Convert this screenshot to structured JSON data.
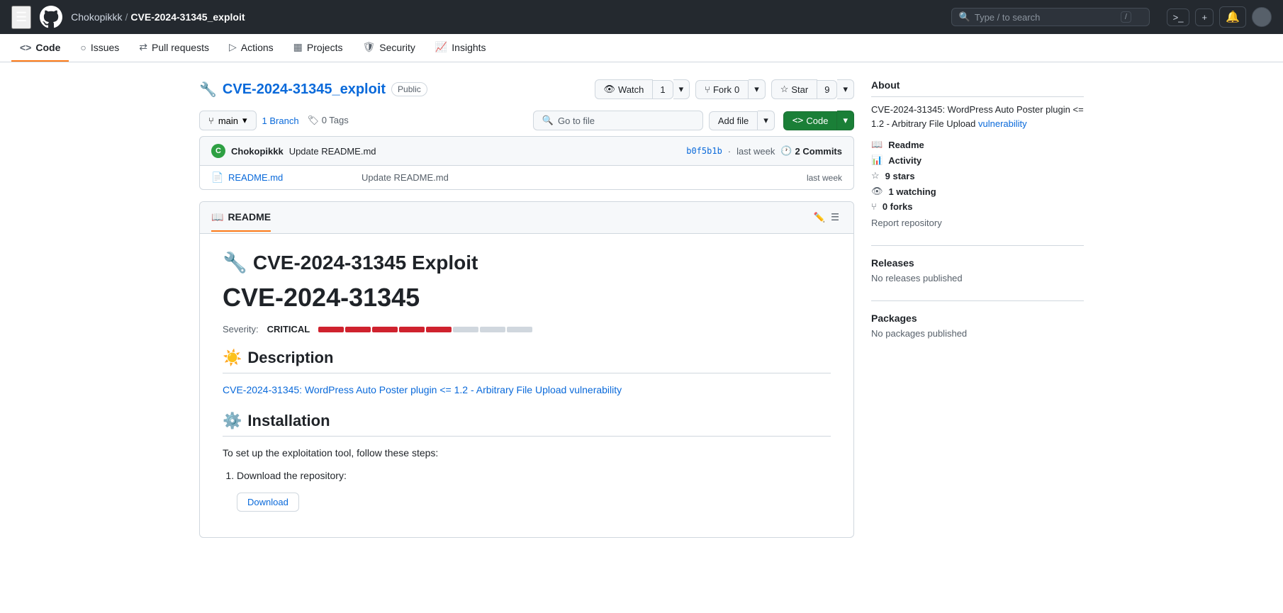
{
  "topbar": {
    "hamburger_label": "☰",
    "user": "Chokopikkk",
    "separator": "/",
    "repo": "CVE-2024-31345_exploit",
    "search_placeholder": "Type / to search",
    "search_shortcut": "/",
    "terminal_icon": ">_",
    "plus_icon": "+",
    "bell_icon": "🔔",
    "menu_icon": "⚙"
  },
  "repo_nav": {
    "items": [
      {
        "label": "Code",
        "icon": "<>",
        "active": true
      },
      {
        "label": "Issues",
        "icon": "○",
        "active": false
      },
      {
        "label": "Pull requests",
        "icon": "⇄",
        "active": false
      },
      {
        "label": "Actions",
        "icon": "▷",
        "active": false
      },
      {
        "label": "Projects",
        "icon": "▦",
        "active": false
      },
      {
        "label": "Security",
        "icon": "🛡",
        "active": false
      },
      {
        "label": "Insights",
        "icon": "📈",
        "active": false
      }
    ]
  },
  "repo": {
    "name": "CVE-2024-31345_exploit",
    "visibility": "Public",
    "avatar_emoji": "🔧"
  },
  "actions": {
    "watch_label": "Watch",
    "watch_count": "1",
    "fork_label": "Fork",
    "fork_count": "0",
    "star_label": "Star",
    "star_count": "9",
    "code_label": "Code"
  },
  "branch": {
    "name": "main",
    "branches_count": "1 Branch",
    "tags_count": "0 Tags",
    "go_to_file_placeholder": "Go to file",
    "add_file_label": "Add file"
  },
  "commit_bar": {
    "author_avatar": "C",
    "author": "Chokopikkk",
    "message": "Update README.md",
    "hash": "b0f5b1b",
    "hash_dot": "·",
    "time": "last week",
    "commits_label": "2 Commits",
    "clock_icon": "🕐"
  },
  "files": [
    {
      "icon": "📄",
      "name": "README.md",
      "commit_msg": "Update README.md",
      "time": "last week"
    }
  ],
  "readme": {
    "section_label": "README",
    "h1_emoji": "🔧",
    "h1_text": "CVE-2024-31345 Exploit",
    "cve_title": "CVE-2024-31345",
    "severity_label": "Severity:",
    "severity_value": "CRITICAL",
    "severity_segments": [
      {
        "filled": true
      },
      {
        "filled": true
      },
      {
        "filled": true
      },
      {
        "filled": true
      },
      {
        "filled": true
      },
      {
        "filled": false
      },
      {
        "filled": false
      },
      {
        "filled": false
      }
    ],
    "desc_emoji": "☀️",
    "desc_heading": "Description",
    "desc_text": "CVE-2024-31345: WordPress Auto Poster plugin <= 1.2 - Arbitrary File Upload vulnerability",
    "install_emoji": "⚙️",
    "install_heading": "Installation",
    "install_intro": "To set up the exploitation tool, follow these steps:",
    "install_step1": "Download the repository:",
    "download_label": "Download"
  },
  "sidebar": {
    "about_title": "About",
    "about_text": "CVE-2024-31345: WordPress Auto Poster plugin <= 1.2 - Arbitrary File Upload vulnerability",
    "about_link_text": "vulnerability",
    "readme_label": "Readme",
    "activity_label": "Activity",
    "stars_label": "9 stars",
    "watching_label": "1 watching",
    "forks_label": "0 forks",
    "report_label": "Report repository",
    "releases_title": "Releases",
    "releases_text": "No releases published",
    "packages_title": "Packages",
    "packages_text": "No packages published"
  }
}
